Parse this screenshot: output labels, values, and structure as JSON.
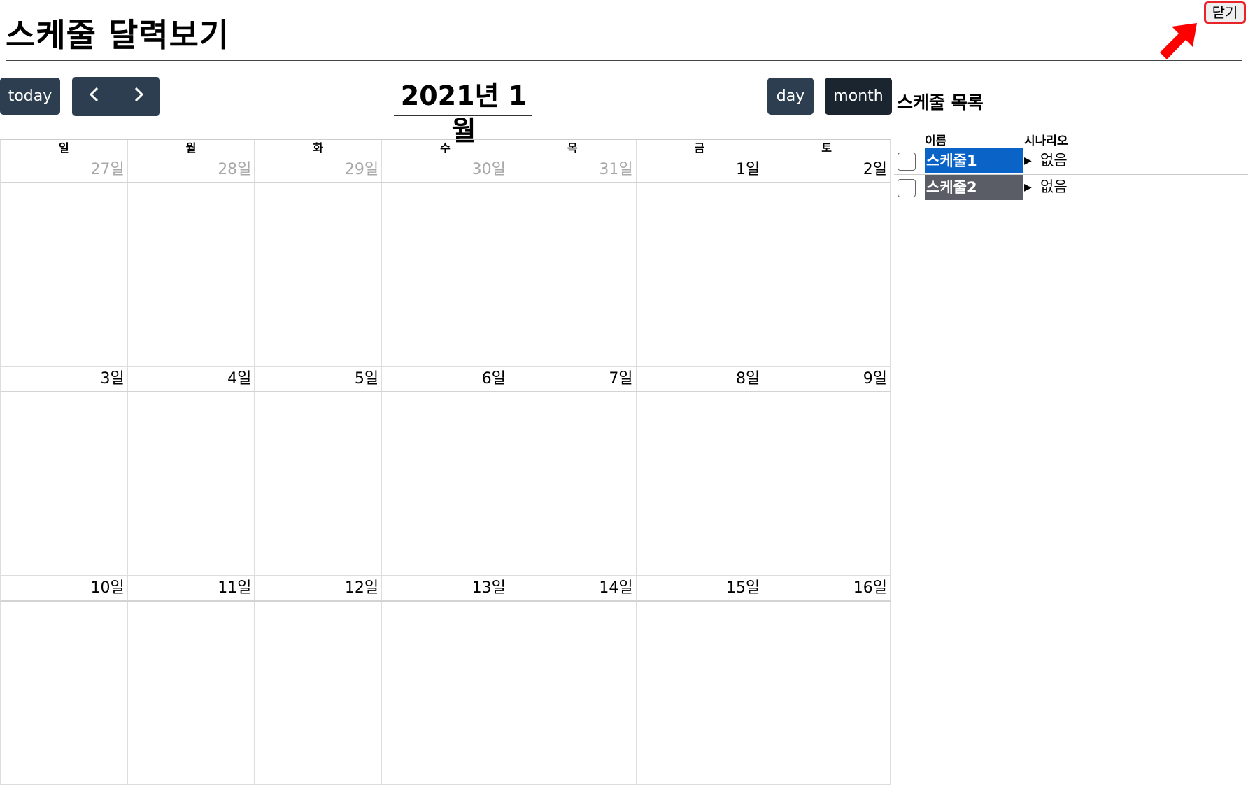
{
  "page": {
    "title": "스케줄 달력보기",
    "close_label": "닫기"
  },
  "toolbar": {
    "today_label": "today",
    "prev_icon": "‹",
    "next_icon": "›",
    "day_label": "day",
    "month_label": "month"
  },
  "calendar": {
    "title": "2021년 1월",
    "weekdays": [
      "일",
      "월",
      "화",
      "수",
      "목",
      "금",
      "토"
    ],
    "weeks": [
      [
        "27일",
        "28일",
        "29일",
        "30일",
        "31일",
        "1일",
        "2일"
      ],
      [
        "3일",
        "4일",
        "5일",
        "6일",
        "7일",
        "8일",
        "9일"
      ],
      [
        "10일",
        "11일",
        "12일",
        "13일",
        "14일",
        "15일",
        "16일"
      ]
    ]
  },
  "schedule_list": {
    "title": "스케줄 목록",
    "columns": {
      "name": "이름",
      "scenario": "시나리오"
    },
    "rows": [
      {
        "name": "스케줄1",
        "scenario": "없음",
        "color": "#0a64c8",
        "checked": false
      },
      {
        "name": "스케줄2",
        "scenario": "없음",
        "color": "#5a5d66",
        "checked": false
      }
    ]
  },
  "colors": {
    "accent_arrow": "#ff0000",
    "toolbar_button": "#2c3e50",
    "active_button": "#1a252f"
  }
}
